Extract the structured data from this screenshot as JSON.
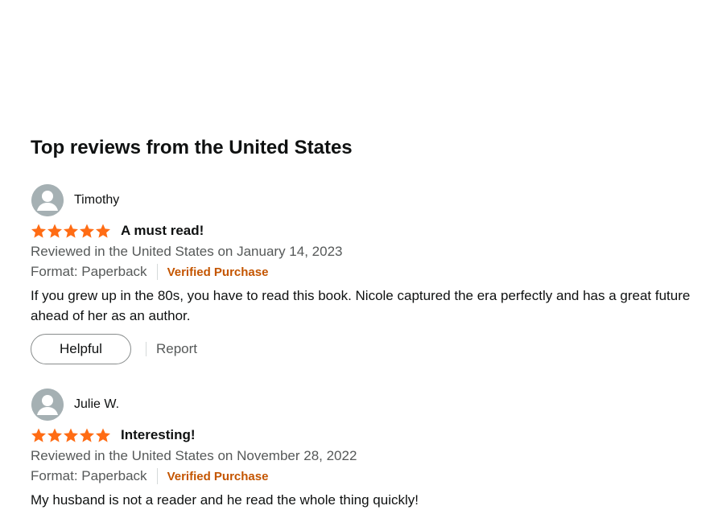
{
  "section": {
    "title": "Top reviews from the United States"
  },
  "reviews": [
    {
      "reviewer": "Timothy",
      "rating": 5,
      "title": "A must read!",
      "date": "Reviewed in the United States on January 14, 2023",
      "format": "Format: Paperback",
      "verified": "Verified Purchase",
      "body": "If you grew up in the 80s, you have to read this book. Nicole captured the era perfectly and has a great future ahead of her as an author.",
      "helpful_label": "Helpful",
      "report_label": "Report"
    },
    {
      "reviewer": "Julie W.",
      "rating": 5,
      "title": "Interesting!",
      "date": "Reviewed in the United States on November 28, 2022",
      "format": "Format: Paperback",
      "verified": "Verified Purchase",
      "body": "My husband is not a reader and he read the whole thing quickly!"
    }
  ],
  "colors": {
    "star": "#ff6c14",
    "verified": "#c45500",
    "secondary_text": "#565959",
    "avatar_bg": "#a5b0b3"
  },
  "icons": {
    "avatar": "user-avatar-icon",
    "star": "star-icon"
  }
}
